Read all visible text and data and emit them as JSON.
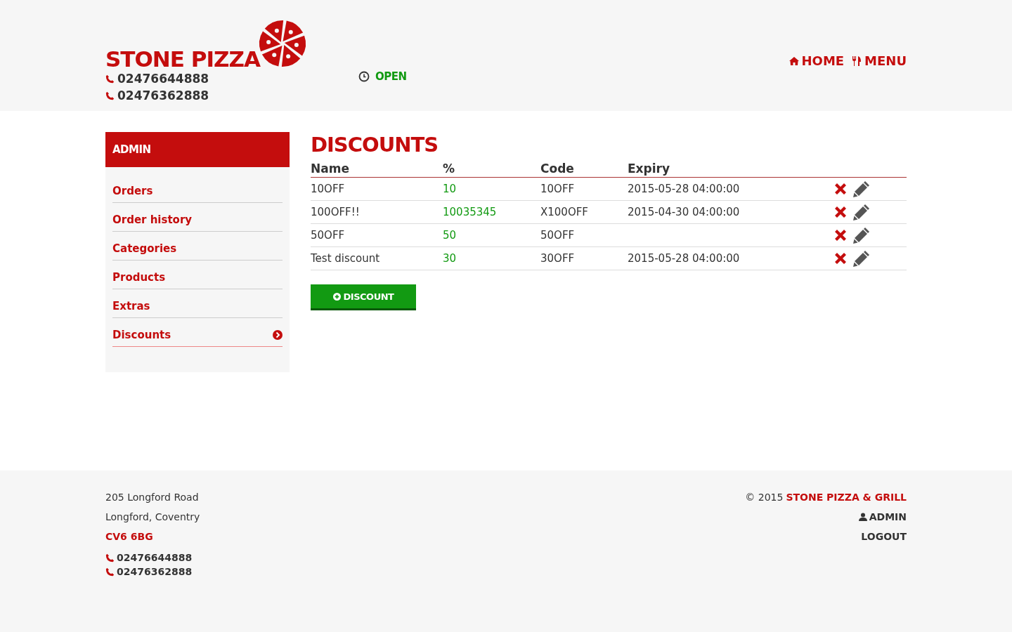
{
  "header": {
    "logo_text": "STONE PIZZA",
    "phones": [
      "02476644888",
      "02476362888"
    ],
    "status": "OPEN",
    "nav": [
      {
        "label": "HOME",
        "kind": "home"
      },
      {
        "label": "MENU",
        "kind": "menu"
      }
    ]
  },
  "sidebar": {
    "title": "ADMIN",
    "items": [
      {
        "label": "Orders",
        "selected": false
      },
      {
        "label": "Order history",
        "selected": false
      },
      {
        "label": "Categories",
        "selected": false
      },
      {
        "label": "Products",
        "selected": false
      },
      {
        "label": "Extras",
        "selected": false
      },
      {
        "label": "Discounts",
        "selected": true
      }
    ]
  },
  "page_title": "DISCOUNTS",
  "table": {
    "columns": [
      "Name",
      "%",
      "Code",
      "Expiry"
    ],
    "rows": [
      {
        "name": "10OFF",
        "percent": "10",
        "code": "10OFF",
        "expiry": "2015-05-28 04:00:00"
      },
      {
        "name": "100OFF!!",
        "percent": "10035345",
        "code": "X100OFF",
        "expiry": "2015-04-30 04:00:00"
      },
      {
        "name": "50OFF",
        "percent": "50",
        "code": "50OFF"
      },
      {
        "name": "Test discount",
        "percent": "30",
        "code": "30OFF",
        "expiry": "2015-05-28 04:00:00"
      }
    ]
  },
  "add_button": "DISCOUNT",
  "footer": {
    "address": [
      "205 Longford Road",
      "Longford, Coventry"
    ],
    "postcode": "CV6 6BG",
    "phones": [
      "02476644888",
      "02476362888"
    ],
    "copyright_prefix": "© 2015",
    "copyright_name": "STONE PIZZA & GRILL",
    "admin": "ADMIN",
    "logout": "LOGOUT"
  }
}
